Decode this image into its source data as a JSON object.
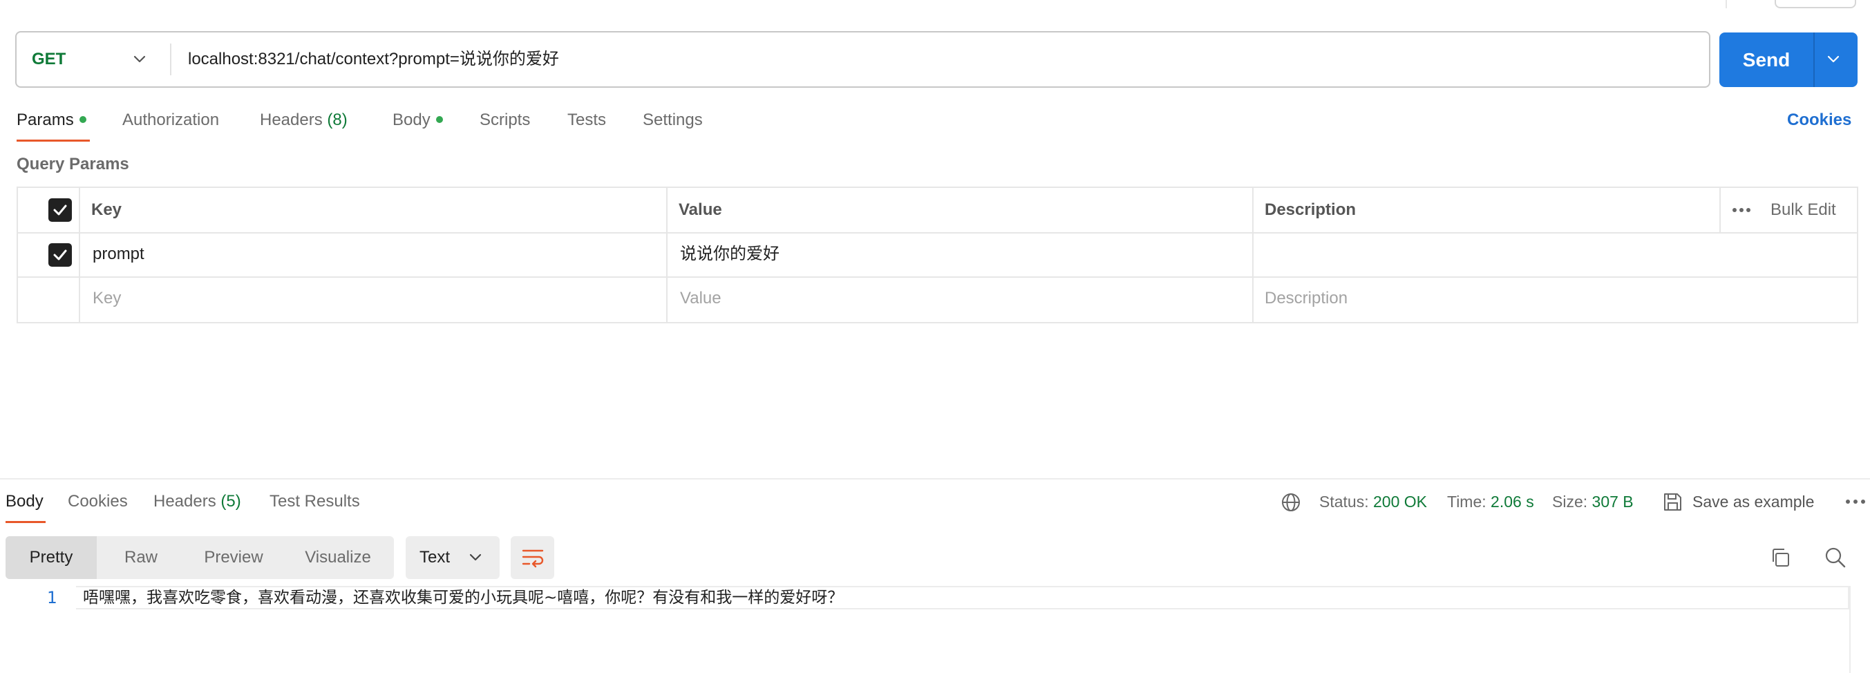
{
  "request": {
    "method": "GET",
    "url": "localhost:8321/chat/context?prompt=说说你的爱好",
    "send_label": "Send"
  },
  "request_tabs": [
    {
      "label": "Params",
      "dot": true,
      "active": true
    },
    {
      "label": "Authorization"
    },
    {
      "label": "Headers",
      "count": "(8)"
    },
    {
      "label": "Body",
      "dot": true
    },
    {
      "label": "Scripts"
    },
    {
      "label": "Tests"
    },
    {
      "label": "Settings"
    }
  ],
  "cookies_label": "Cookies",
  "query_params": {
    "title": "Query Params",
    "headers": {
      "key": "Key",
      "value": "Value",
      "description": "Description",
      "bulk_edit": "Bulk Edit"
    },
    "rows": [
      {
        "checked": true,
        "key": "prompt",
        "value": "说说你的爱好",
        "description": ""
      }
    ],
    "placeholder": {
      "key": "Key",
      "value": "Value",
      "description": "Description"
    }
  },
  "response": {
    "tabs": [
      {
        "label": "Body",
        "active": true
      },
      {
        "label": "Cookies"
      },
      {
        "label": "Headers",
        "count": "(5)"
      },
      {
        "label": "Test Results"
      }
    ],
    "status_label": "Status:",
    "status_value": "200 OK",
    "time_label": "Time:",
    "time_value": "2.06 s",
    "size_label": "Size:",
    "size_value": "307 B",
    "save_example": "Save as example",
    "view_modes": [
      "Pretty",
      "Raw",
      "Preview",
      "Visualize"
    ],
    "active_view": "Pretty",
    "format": "Text",
    "lines": [
      {
        "num": "1",
        "text": "唔嘿嘿，我喜欢吃零食，喜欢看动漫，还喜欢收集可爱的小玩具呢~嘻嘻，你呢？有没有和我一样的爱好呀？"
      }
    ]
  },
  "colors": {
    "send": "#1f7ae0",
    "method": "#0f7a38",
    "accent_underline": "#e8582a",
    "link": "#1f6fd1",
    "success": "#0f7a38"
  }
}
